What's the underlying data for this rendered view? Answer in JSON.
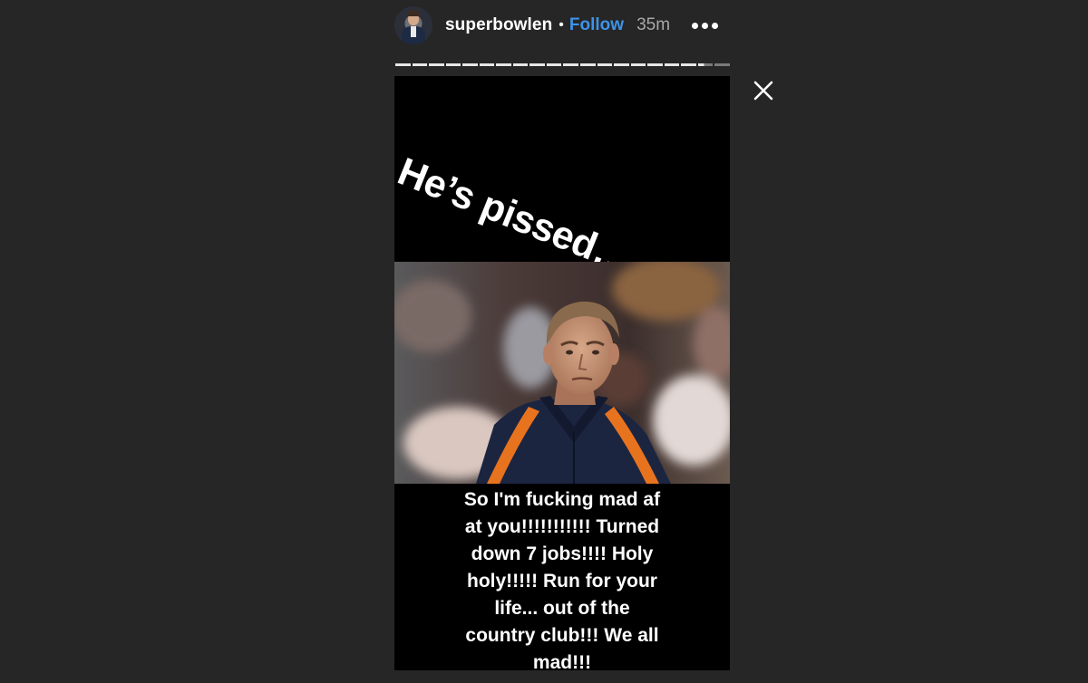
{
  "header": {
    "username": "superbowlen",
    "separator": "•",
    "follow_label": "Follow",
    "time_ago": "35m"
  },
  "icons": {
    "avatar": "profile-avatar",
    "more": "more-options-icon",
    "close": "close-icon"
  },
  "progress": {
    "segment_count": 20,
    "current_segment": 19,
    "current_segment_progress": 0.4
  },
  "story": {
    "top_caption": "He’s pissed….",
    "bottom_caption_lines": [
      "So I'm fucking mad af",
      "at you!!!!!!!!!!! Turned",
      "down 7 jobs!!!! Holy",
      "holy!!!!! Run for your",
      "life... out of the",
      "country club!!! We all",
      "mad!!!"
    ]
  },
  "colors": {
    "background": "#262626",
    "follow_link": "#3d93e8",
    "time_text": "#a8a8a8",
    "jacket_navy": "#1c2540",
    "jacket_orange": "#e8731f"
  }
}
